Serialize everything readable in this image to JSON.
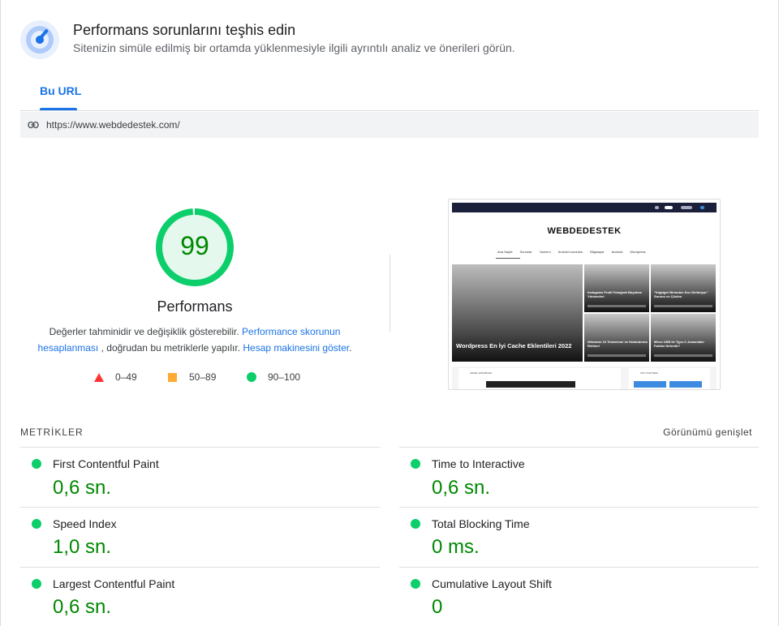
{
  "header": {
    "title": "Performans sorunlarını teşhis edin",
    "subtitle": "Sitenizin simüle edilmiş bir ortamda yüklenmesiyle ilgili ayrıntılı analiz ve önerileri görün.",
    "icon": "speed-gauge-icon"
  },
  "tabs": [
    {
      "label": "Bu URL",
      "active": true
    }
  ],
  "url_bar": {
    "icon": "link-icon",
    "url": "https://www.webdedestek.com/"
  },
  "score": {
    "value": "99",
    "score_fraction": 0.99,
    "label": "Performans",
    "color": "#0cce6b",
    "text_color": "#008800"
  },
  "description": {
    "part1": "Değerler tahminidir ve değişiklik gösterebilir. ",
    "link1": "Performance skorunun hesaplanması",
    "part2": " , doğrudan bu metriklerle yapılır. ",
    "link2": "Hesap makinesini göster",
    "part3": "."
  },
  "legend": [
    {
      "range": "0–49",
      "color": "#ff3333",
      "shape": "triangle"
    },
    {
      "range": "50–89",
      "color": "#ffaa33",
      "shape": "square"
    },
    {
      "range": "90–100",
      "color": "#0cce6b",
      "shape": "circle"
    }
  ],
  "preview": {
    "logo": "WEBDEDESTEK",
    "nav": [
      "Ana Sayfa",
      "Sorunlar",
      "Yazılımı",
      "Android sorunları",
      "Bilgisayar",
      "Android",
      "Wordpress"
    ],
    "main_title": "Wordpress En İyi Cache Eklentileri 2022",
    "cards": [
      "Instagram Profil Fotoğrafı Büyütme Yöntemleri",
      "\"Kağıtgiri Birimden Sıcı Girilmiyor\" Sorunu ve Çözüm",
      "Windows 10 Temizleme ve Hızlandırma Rehberi",
      "Micro USB ile Type-C Arasındaki Farklar Nelerdir?"
    ],
    "section_left": "GENEL ERİŞİMLER",
    "section_right": "SON TARTIŞMA"
  },
  "metrics": {
    "heading": "METRİKLER",
    "expand_label": "Görünümü genişlet",
    "items": [
      {
        "name": "First Contentful Paint",
        "value": "0,6 sn.",
        "status": "good"
      },
      {
        "name": "Time to Interactive",
        "value": "0,6 sn.",
        "status": "good"
      },
      {
        "name": "Speed Index",
        "value": "1,0 sn.",
        "status": "good"
      },
      {
        "name": "Total Blocking Time",
        "value": "0 ms.",
        "status": "good"
      },
      {
        "name": "Largest Contentful Paint",
        "value": "0,6 sn.",
        "status": "good"
      },
      {
        "name": "Cumulative Layout Shift",
        "value": "0",
        "status": "good"
      }
    ]
  }
}
